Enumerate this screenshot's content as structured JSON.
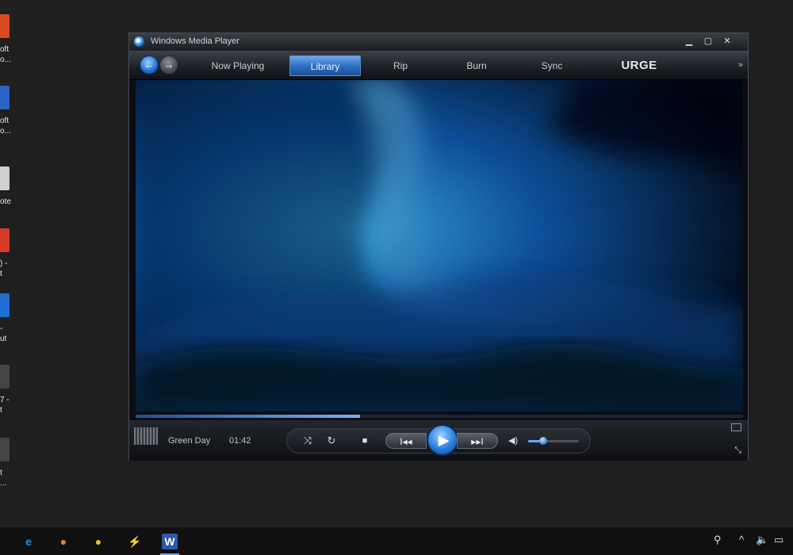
{
  "desktop": {
    "icons": [
      {
        "label": "oft\no...",
        "color": "#d84b20"
      },
      {
        "label": "oft\no...",
        "color": "#2b63c6"
      },
      {
        "label": "ote",
        "color": "#d0d0d0"
      },
      {
        "label": ") -\nt",
        "color": "#d63a2a"
      },
      {
        "label": "-\nut",
        "color": "#1f6fd6"
      },
      {
        "label": "7 -\nt",
        "color": "#444"
      },
      {
        "label": "t\n...",
        "color": "#444"
      }
    ]
  },
  "window": {
    "title": "Windows Media Player",
    "buttons": {
      "minimize": "▁",
      "maximize": "▢",
      "close": "✕"
    }
  },
  "nav": {
    "back_icon": "back-arrow-icon",
    "forward_icon": "forward-arrow-icon",
    "tabs": [
      {
        "label": "Now Playing",
        "active": false
      },
      {
        "label": "Library",
        "active": true
      },
      {
        "label": "Rip",
        "active": false
      },
      {
        "label": "Burn",
        "active": false
      },
      {
        "label": "Sync",
        "active": false
      },
      {
        "label": "URGE",
        "active": false
      }
    ],
    "more_glyph": "»"
  },
  "player": {
    "artist": "Green Day",
    "time": "01:42",
    "seek_progress": 0.37,
    "volume_level": 0.3,
    "controls": {
      "shuffle_glyph": "⤨",
      "repeat_glyph": "↻",
      "stop_glyph": "■",
      "prev_glyph": "I◂◂",
      "play_glyph": "▶",
      "next_glyph": "▸▸I",
      "mute_glyph": "◀)"
    }
  },
  "taskbar": {
    "apps": [
      {
        "name": "edge",
        "glyph": "e",
        "color": "#1f8ee8",
        "bg": "transparent"
      },
      {
        "name": "firefox",
        "glyph": "●",
        "color": "#ff7a1a",
        "bg": "transparent"
      },
      {
        "name": "chrome",
        "glyph": "●",
        "color": "#e8c22a",
        "bg": "transparent"
      },
      {
        "name": "app",
        "glyph": "⚡",
        "color": "#e2b23a",
        "bg": "transparent"
      },
      {
        "name": "word",
        "glyph": "W",
        "color": "#ffffff",
        "bg": "#2b5aa8"
      }
    ],
    "tray": {
      "people": "⚲",
      "chevron": "^",
      "volume": "🔈",
      "network": "▭"
    }
  }
}
